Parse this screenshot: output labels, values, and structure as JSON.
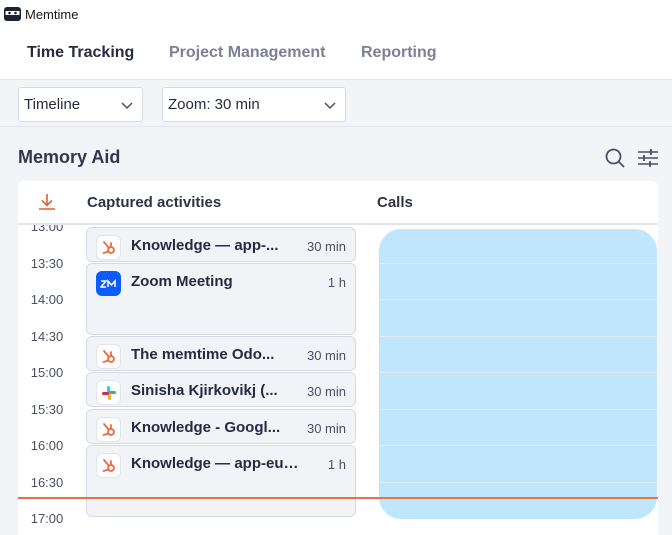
{
  "app": {
    "title": "Memtime"
  },
  "nav": {
    "tabs": [
      {
        "label": "Time Tracking",
        "active": true
      },
      {
        "label": "Project Management",
        "active": false
      },
      {
        "label": "Reporting",
        "active": false
      }
    ]
  },
  "toolbar": {
    "view_select": "Timeline",
    "zoom_select": "Zoom: 30 min"
  },
  "memory_aid": {
    "title": "Memory Aid",
    "columns": {
      "activities": "Captured activities",
      "calls": "Calls"
    },
    "times": [
      "13:00",
      "13:30",
      "14:00",
      "14:30",
      "15:00",
      "15:30",
      "16:00",
      "16:30",
      "17:00"
    ],
    "activities": [
      {
        "app_icon": "hubspot-icon",
        "title": "Knowledge — app-...",
        "duration": "30 min"
      },
      {
        "app_icon": "zoom-icon",
        "title": "Zoom Meeting",
        "duration": "1 h"
      },
      {
        "app_icon": "hubspot-icon",
        "title": "The memtime Odo...",
        "duration": "30 min"
      },
      {
        "app_icon": "slack-icon",
        "title": "Sinisha Kjirkovikj (...",
        "duration": "30 min"
      },
      {
        "app_icon": "hubspot-icon",
        "title": "Knowledge - Googl...",
        "duration": "30 min"
      },
      {
        "app_icon": "hubspot-icon",
        "title": "Knowledge — app-eu1....",
        "duration": "1 h"
      }
    ]
  },
  "colors": {
    "accent_now_line": "#e8704c",
    "call_block": "#bfe6fb",
    "active_tab": "#262b40",
    "inactive_tab": "#7b8097"
  }
}
